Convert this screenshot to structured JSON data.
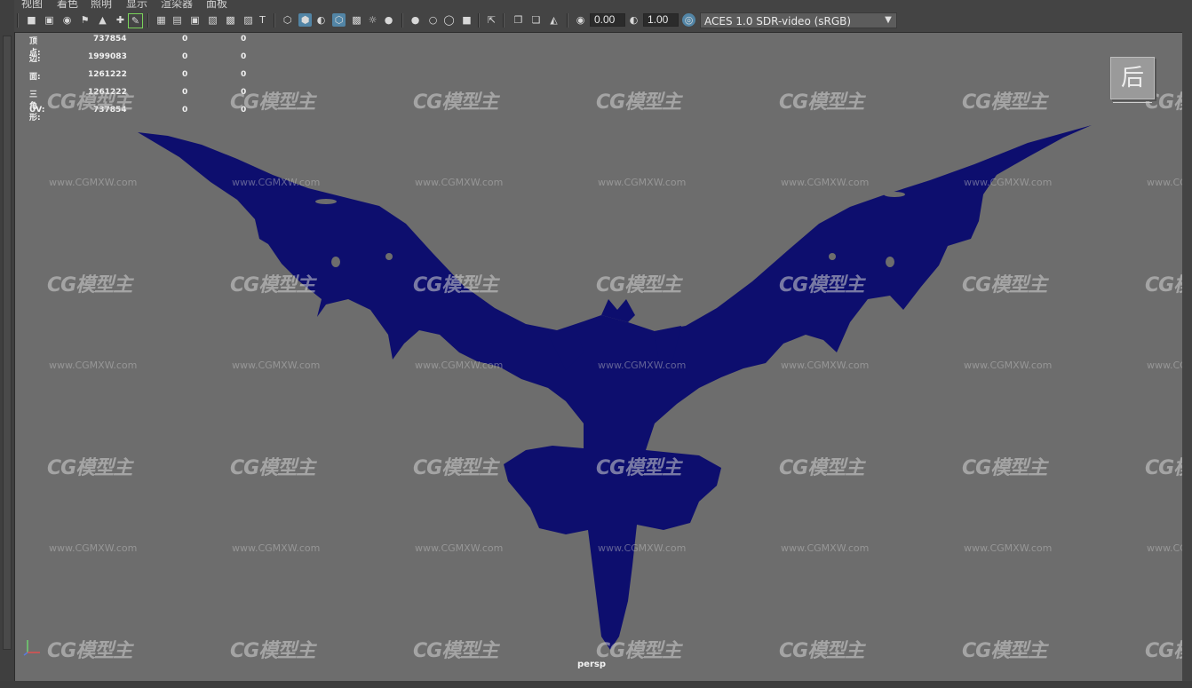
{
  "menu": {
    "items": [
      "视图",
      "着色",
      "照明",
      "显示",
      "渲染器",
      "面板"
    ]
  },
  "toolbar": {
    "exposure_value": "0.00",
    "gamma_value": "1.00",
    "color_space": "ACES 1.0 SDR-video (sRGB)"
  },
  "hud": {
    "rows": [
      {
        "label": "顶点:",
        "count": "737854",
        "a": "0",
        "b": "0"
      },
      {
        "label": "边:",
        "count": "1999083",
        "a": "0",
        "b": "0"
      },
      {
        "label": "面:",
        "count": "1261222",
        "a": "0",
        "b": "0"
      },
      {
        "label": "三角形:",
        "count": "1261222",
        "a": "0",
        "b": "0"
      },
      {
        "label": "UV:",
        "count": "737854",
        "a": "0",
        "b": "0"
      }
    ]
  },
  "view_cube": {
    "label": "后"
  },
  "camera": {
    "name": "persp"
  },
  "watermark": {
    "logo": "CG模型主",
    "url": "www.CGMXW.com"
  },
  "colors": {
    "viewport_bg": "#6d6d6d",
    "model": "#0d0e6e",
    "accent": "#5285a6"
  }
}
